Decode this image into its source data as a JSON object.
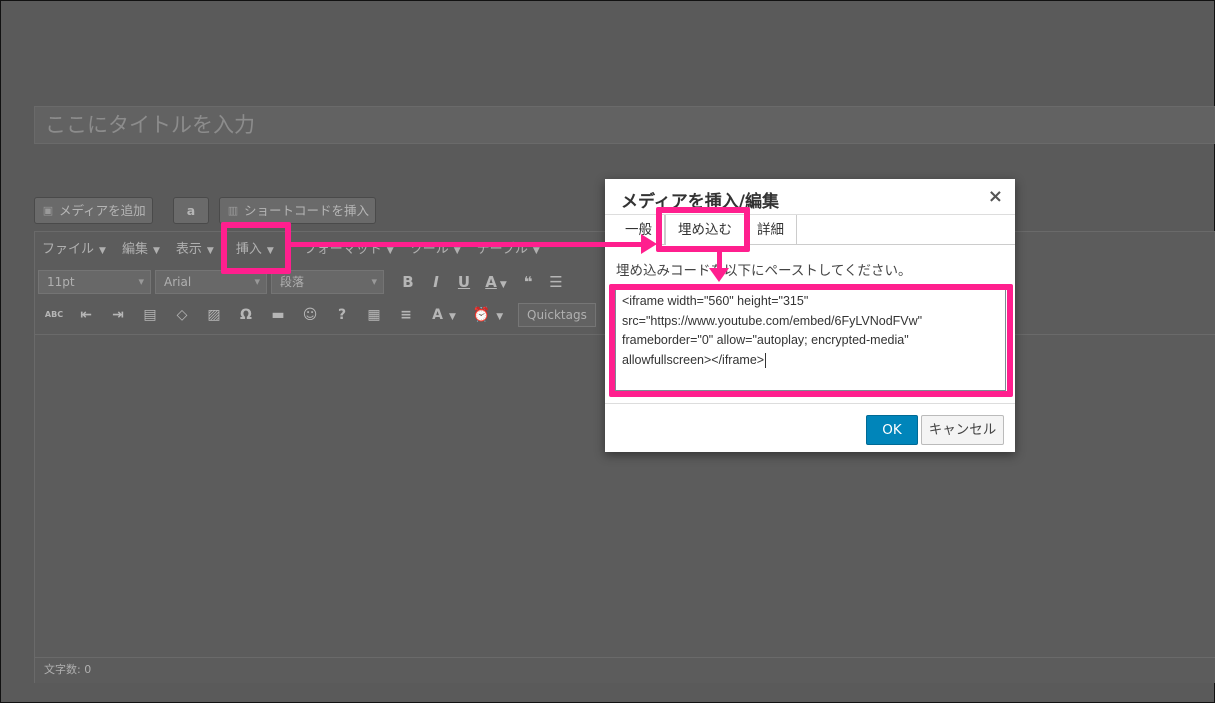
{
  "title_placeholder": "ここにタイトルを入力",
  "media_buttons": {
    "add_media": "メディアを追加",
    "amazon": "a",
    "shortcode": "ショートコードを挿入"
  },
  "menubar": {
    "file": "ファイル",
    "edit": "編集",
    "view": "表示",
    "insert": "挿入",
    "format": "フォーマット",
    "tools": "ツール",
    "table": "テーブル"
  },
  "toolbar": {
    "font_size": "11pt",
    "font_family": "Arial",
    "paragraph": "段落",
    "bold": "B",
    "italic": "I",
    "underline": "U",
    "text_color": "A",
    "quote": "❝",
    "quicktags": "Quicktags"
  },
  "statusbar": {
    "word_count": "文字数: 0"
  },
  "dialog": {
    "title": "メディアを挿入/編集",
    "close": "×",
    "tabs": [
      "一般",
      "埋め込む",
      "詳細"
    ],
    "instruction": "埋め込みコードを以下にペーストしてください。",
    "code_lines": [
      "<iframe width=\"560\" height=\"315\"",
      "src=\"https://www.youtube.com/embed/6FyLVNodFVw\"",
      "frameborder=\"0\" allow=\"autoplay; encrypted-media\"",
      "allowfullscreen></iframe>"
    ],
    "ok": "OK",
    "cancel": "キャンセル"
  },
  "colors": {
    "highlight": "#ff1f8e",
    "ok_button": "#0085ba",
    "overlay_bg": "#5a5a5a"
  }
}
